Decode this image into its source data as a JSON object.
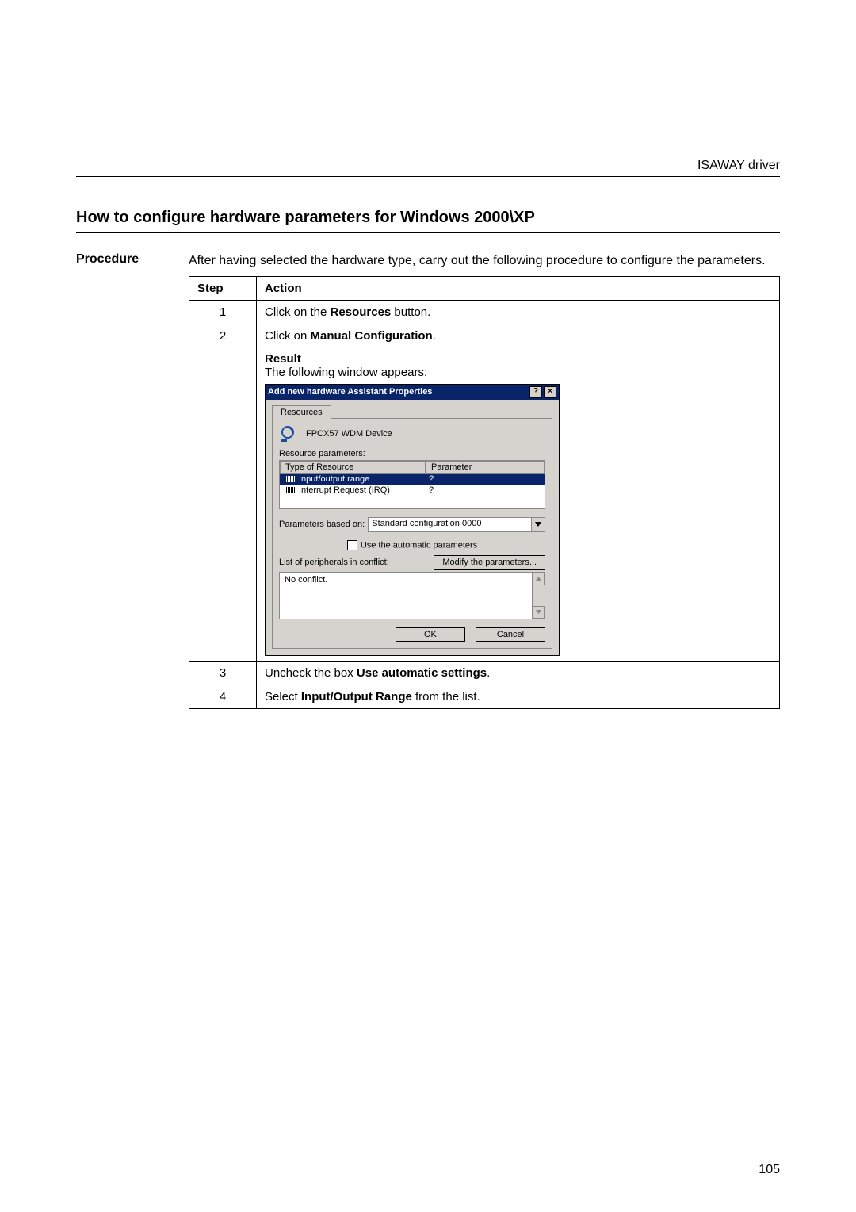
{
  "header": {
    "right": "ISAWAY driver"
  },
  "section_title": "How to configure hardware parameters for Windows 2000\\XP",
  "procedure": {
    "label": "Procedure",
    "intro": "After having selected the hardware type, carry out the following procedure to configure the parameters.",
    "columns": {
      "step": "Step",
      "action": "Action"
    },
    "rows": {
      "r1": {
        "step": "1",
        "prefix": "Click on the ",
        "bold": "Resources",
        "suffix": " button."
      },
      "r2": {
        "step": "2",
        "line1_prefix": "Click on ",
        "line1_bold": "Manual Configuration",
        "line1_suffix": ".",
        "result_label": "Result",
        "result_text": "The following window appears:"
      },
      "r3": {
        "step": "3",
        "prefix": "Uncheck the box ",
        "bold": "Use automatic settings",
        "suffix": "."
      },
      "r4": {
        "step": "4",
        "prefix": "Select ",
        "bold": "Input/Output Range",
        "suffix": " from the list."
      }
    }
  },
  "dialog": {
    "title": "Add new hardware Assistant Properties",
    "help_btn": "?",
    "close_btn": "×",
    "tab": "Resources",
    "device": "FPCX57 WDM Device",
    "resource_parameters_label": "Resource parameters:",
    "list_headers": {
      "type": "Type of Resource",
      "param": "Parameter"
    },
    "list_rows": {
      "r1": {
        "type": "Input/output range",
        "param": "?"
      },
      "r2": {
        "type": "Interrupt Request (IRQ)",
        "param": "?"
      }
    },
    "params_based_label": "Parameters based on:",
    "params_based_value": "Standard configuration 0000",
    "auto_checkbox_label": "Use the automatic parameters",
    "conflict_label": "List of peripherals in conflict:",
    "modify_btn": "Modify the parameters...",
    "conflict_text": "No conflict.",
    "ok_btn": "OK",
    "cancel_btn": "Cancel"
  },
  "page_number": "105"
}
